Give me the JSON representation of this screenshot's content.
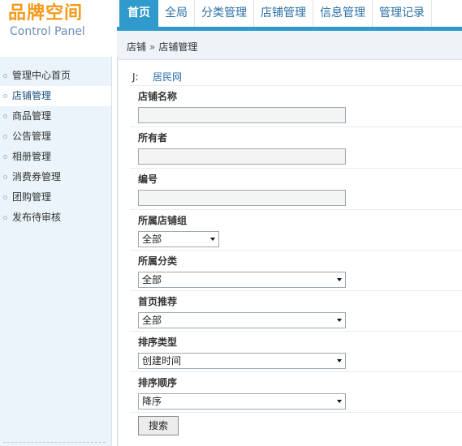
{
  "logo": {
    "title": "品牌空间",
    "subtitle": "Control Panel"
  },
  "topnav": [
    {
      "label": "首页",
      "active": true
    },
    {
      "label": "全局"
    },
    {
      "label": "分类管理"
    },
    {
      "label": "店铺管理"
    },
    {
      "label": "信息管理"
    },
    {
      "label": "管理记录"
    }
  ],
  "breadcrumb": {
    "parent": "店铺",
    "separator": "»",
    "current": "店铺管理"
  },
  "sidebar": [
    {
      "label": "管理中心首页"
    },
    {
      "label": "店铺管理",
      "active": true
    },
    {
      "label": "商品管理"
    },
    {
      "label": "公告管理"
    },
    {
      "label": "相册管理"
    },
    {
      "label": "消费券管理"
    },
    {
      "label": "团购管理"
    },
    {
      "label": "发布待审核"
    }
  ],
  "form": {
    "community": {
      "key": "J:",
      "value": "居民网"
    },
    "shop_name": {
      "label": "店铺名称",
      "value": ""
    },
    "owner": {
      "label": "所有者",
      "value": ""
    },
    "number": {
      "label": "编号",
      "value": ""
    },
    "shop_group": {
      "label": "所属店铺组",
      "selected": "全部"
    },
    "category": {
      "label": "所属分类",
      "selected": "全部"
    },
    "recommend": {
      "label": "首页推荐",
      "selected": "全部"
    },
    "sort_type": {
      "label": "排序类型",
      "selected": "创建时间"
    },
    "sort_order": {
      "label": "排序顺序",
      "selected": "降序"
    },
    "search_button": "搜索"
  }
}
